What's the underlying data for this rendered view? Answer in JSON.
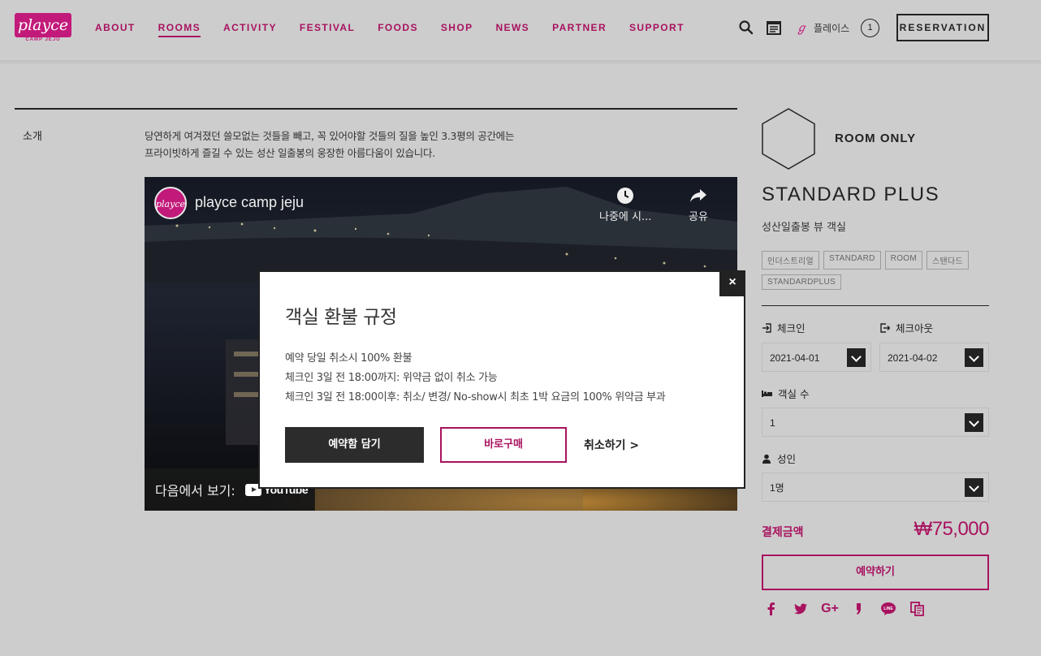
{
  "brand": {
    "logo_text": "playce",
    "logo_sub": "CAMP JEJU",
    "color": "#c21a7a",
    "accent": "#a8125f"
  },
  "nav": {
    "items": [
      {
        "label": "ABOUT"
      },
      {
        "label": "ROOMS",
        "active": true
      },
      {
        "label": "ACTIVITY"
      },
      {
        "label": "FESTIVAL"
      },
      {
        "label": "FOODS"
      },
      {
        "label": "SHOP"
      },
      {
        "label": "NEWS"
      },
      {
        "label": "PARTNER"
      },
      {
        "label": "SUPPORT"
      }
    ]
  },
  "header": {
    "icons": [
      "search-icon",
      "calendar-icon",
      "playce-mini-logo"
    ],
    "user_name": "플레이스",
    "cart_count": "1",
    "reservation_label": "RESERVATION"
  },
  "intro": {
    "label": "소개",
    "line1": "당연하게 여겨졌던 쓸모없는 것들을 빼고, 꼭 있어야할 것들의 질을 높인 3.3평의 공간에는",
    "line2": "프라이빗하게 즐길 수 있는 성산 일출봉의 웅장한 아름다움이 있습니다."
  },
  "video": {
    "channel_avatar": "playce",
    "title": "playce camp jeju",
    "watch_later": "나중에 시...",
    "share": "공유",
    "watch_on": "다음에서 보기:",
    "youtube": "YouTube"
  },
  "room": {
    "plan": "ROOM ONLY",
    "name": "STANDARD PLUS",
    "description": "성산일출봉 뷰 객실",
    "tags": [
      "인더스트리얼",
      "STANDARD",
      "ROOM",
      "스탠다드",
      "STANDARDPLUS"
    ]
  },
  "booking": {
    "checkin_label": "체크인",
    "checkin_value": "2021-04-01",
    "checkout_label": "체크아웃",
    "checkout_value": "2021-04-02",
    "rooms_label": "객실 수",
    "rooms_value": "1",
    "adults_label": "성인",
    "adults_value": "1명",
    "total_label": "결제금액",
    "total_price": "₩75,000",
    "book_label": "예약하기"
  },
  "share": {
    "icons": [
      "facebook-icon",
      "twitter-icon",
      "google-plus-icon",
      "kakaostory-icon",
      "line-icon",
      "copy-link-icon"
    ],
    "gplus_text": "G+",
    "line_text": "LINE"
  },
  "modal": {
    "close": "×",
    "title": "객실 환불 규정",
    "line1": "예약 당일 취소시 100% 환불",
    "line2": "체크인 3일 전 18:00까지: 위약금 없이 취소 가능",
    "line3": "체크인 3일 전 18:00이후: 취소/ 변경/ No-show시 최초 1박 요금의 100% 위약금 부과",
    "cart_button": "예약함 담기",
    "buy_button": "바로구매",
    "cancel_link": "취소하기 >"
  }
}
